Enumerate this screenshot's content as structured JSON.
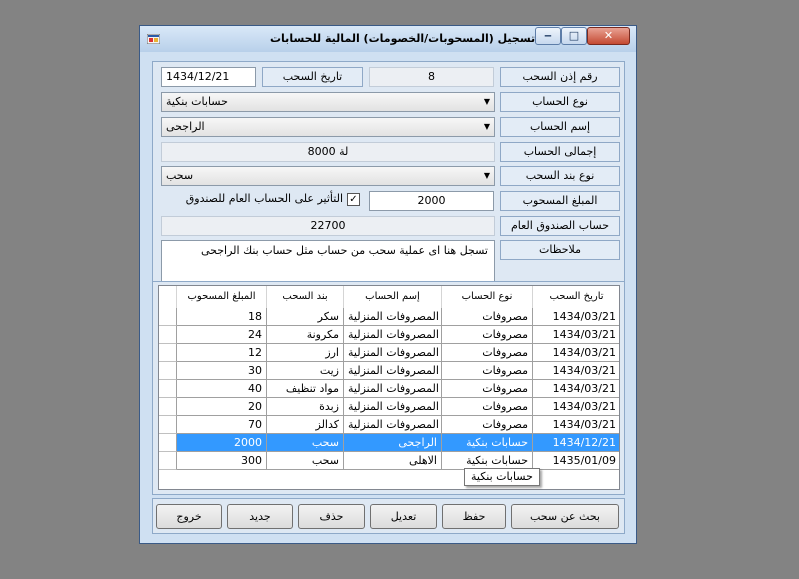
{
  "window": {
    "title": "تسجيل (المسحوبات/الخصومات) المالية للحسابات",
    "min_glyph": "‒",
    "max_glyph": "□",
    "close_glyph": "✕"
  },
  "form": {
    "withdrawal_no_label": "رقم إذن السحب",
    "withdrawal_no_value": "8",
    "withdrawal_date_label": "تاريخ السحب",
    "withdrawal_date_value": "1434/12/21",
    "account_type_label": "نوع الحساب",
    "account_type_value": "حسابات بنكية",
    "account_name_label": "إسم الحساب",
    "account_name_value": "الراجحى",
    "account_total_label": "إجمالى الحساب",
    "account_total_value": "ﻟﺔ 8000",
    "item_type_label": "نوع بند السحب",
    "item_type_value": "سحب",
    "amount_label": "المبلغ المسحوب",
    "amount_value": "2000",
    "affect_checkbox_label": "التأثير على الحساب العام للصندوق",
    "affect_checked": true,
    "fund_account_label": "حساب الصندوق العام",
    "fund_account_value": "22700",
    "notes_label": "ملاحظات",
    "notes_value": "تسجل هنا اى عملية سحب من حساب مثل حساب بنك الراجحى"
  },
  "table": {
    "columns": [
      "تاريخ السحب",
      "نوع الحساب",
      "إسم الحساب",
      "بند السحب",
      "المبلغ المسحوب"
    ],
    "rows": [
      [
        "1434/03/21",
        "مصروفات",
        "المصروفات المنزلية",
        "سكر",
        "18"
      ],
      [
        "1434/03/21",
        "مصروفات",
        "المصروفات المنزلية",
        "مكرونة",
        "24"
      ],
      [
        "1434/03/21",
        "مصروفات",
        "المصروفات المنزلية",
        "ارز",
        "12"
      ],
      [
        "1434/03/21",
        "مصروفات",
        "المصروفات المنزلية",
        "زيت",
        "30"
      ],
      [
        "1434/03/21",
        "مصروفات",
        "المصروفات المنزلية",
        "مواد تنظيف",
        "40"
      ],
      [
        "1434/03/21",
        "مصروفات",
        "المصروفات المنزلية",
        "زبدة",
        "20"
      ],
      [
        "1434/03/21",
        "مصروفات",
        "المصروفات المنزلية",
        "كدالز",
        "70"
      ],
      [
        "1434/12/21",
        "حسابات بنكية",
        "الراجحى",
        "سحب",
        "2000"
      ],
      [
        "1435/01/09",
        "حسابات بنكية",
        "الاهلى",
        "سحب",
        "300"
      ]
    ],
    "selected_row": 7,
    "tooltip": "حسابات بنكية"
  },
  "buttons": {
    "search": "بحث عن سحب",
    "save": "حفظ",
    "edit": "تعديل",
    "delete": "حذف",
    "new": "جديد",
    "exit": "خروج"
  },
  "colors": {
    "selection": "#3399ff",
    "window_bg": "#cfe0f2",
    "desktop": "#838383"
  }
}
